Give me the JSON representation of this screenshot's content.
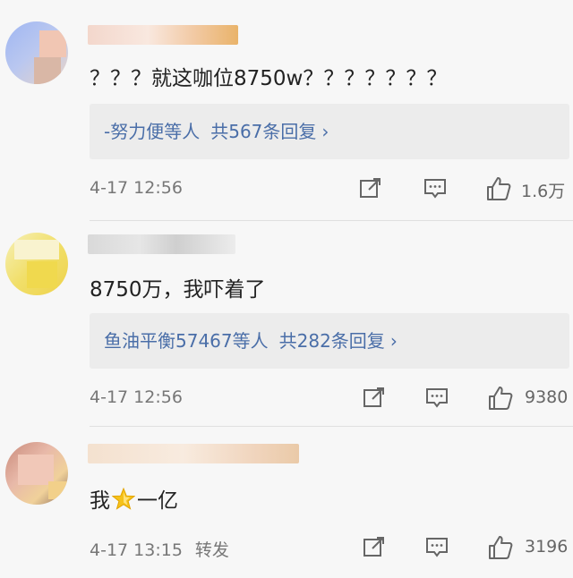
{
  "comments": [
    {
      "text": "？？？就这咖位8750w？？？？？？？",
      "reply": {
        "who": "-努力便等人",
        "count": "共567条回复",
        "chevron": "›"
      },
      "time": "4-17 12:56",
      "repost": "",
      "likes": "1.6万"
    },
    {
      "text": "8750万，我吓着了",
      "reply": {
        "who": "鱼油平衡57467等人",
        "count": "共282条回复",
        "chevron": "›"
      },
      "time": "4-17 12:56",
      "repost": "",
      "likes": "9380"
    },
    {
      "text_before": "我",
      "emoji": "star-emoji",
      "text_after": "一亿",
      "time": "4-17 13:15",
      "repost": "转发",
      "likes": "3196"
    }
  ],
  "colors": {
    "link": "#4a6ea8",
    "background": "#f7f7f7",
    "reply_bg": "#ececec"
  }
}
